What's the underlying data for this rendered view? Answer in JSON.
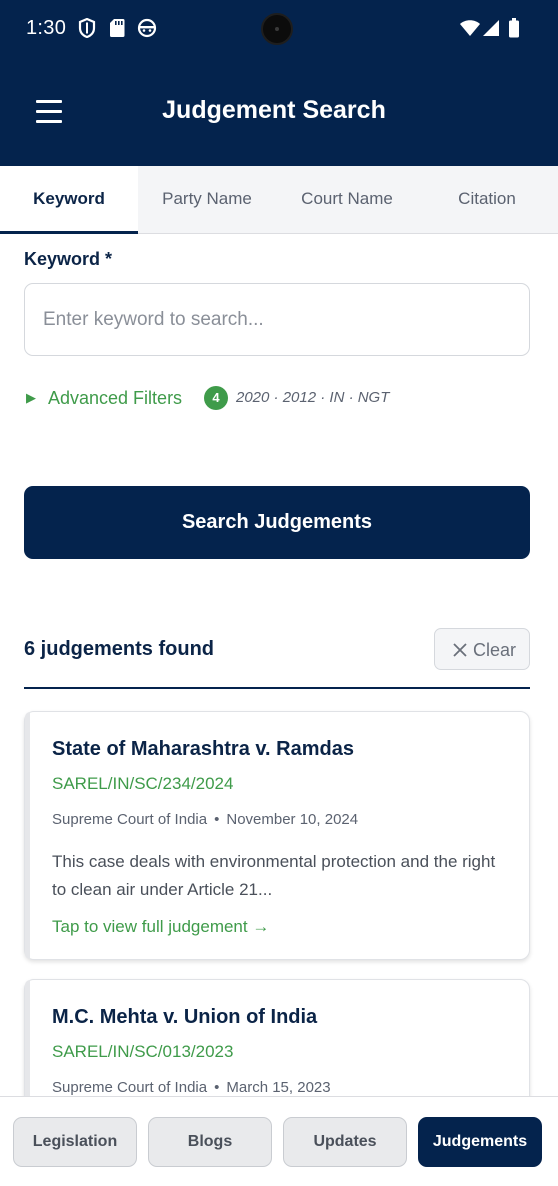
{
  "status_bar": {
    "time": "1:30",
    "icons": [
      "shield-icon",
      "sd-card-icon",
      "android-icon",
      "wifi-icon",
      "signal-icon",
      "battery-icon"
    ]
  },
  "header": {
    "title": "Judgement Search",
    "menu_icon": "hamburger-menu-icon"
  },
  "tabs": [
    {
      "label": "Keyword",
      "active": true
    },
    {
      "label": "Party Name",
      "active": false
    },
    {
      "label": "Court Name",
      "active": false
    },
    {
      "label": "Citation",
      "active": false
    }
  ],
  "search": {
    "label": "Keyword *",
    "value": "",
    "placeholder": "Enter keyword to search...",
    "advanced_filters_label": "Advanced Filters",
    "advanced_filters_icon": "triangle-right-icon",
    "active_filter_count": "4",
    "active_filters_summary": "2020 · 2012 · IN · NGT",
    "submit_label": "Search Judgements"
  },
  "results": {
    "count_text": "6 judgements found",
    "clear_label": "Clear",
    "clear_icon": "close-icon",
    "items": [
      {
        "title": "State of Maharashtra v. Ramdas",
        "citation": "SAREL/IN/SC/234/2024",
        "court": "Supreme Court of India",
        "date": "November 10, 2024",
        "description": "This case deals with environmental protection and the right to clean air under Article 21...",
        "link_text": "Tap to view full judgement →"
      },
      {
        "title": "M.C. Mehta v. Union of India",
        "citation": "SAREL/IN/SC/013/2023",
        "court": "Supreme Court of India",
        "date": "March 15, 2023"
      }
    ]
  },
  "bottom_nav": [
    {
      "label": "Legislation",
      "active": false
    },
    {
      "label": "Blogs",
      "active": false
    },
    {
      "label": "Updates",
      "active": false
    },
    {
      "label": "Judgements",
      "active": true
    }
  ],
  "colors": {
    "primary_navy": "#04234d",
    "accent_green": "#3f9b4a",
    "surface_gray": "#f4f5f7"
  }
}
